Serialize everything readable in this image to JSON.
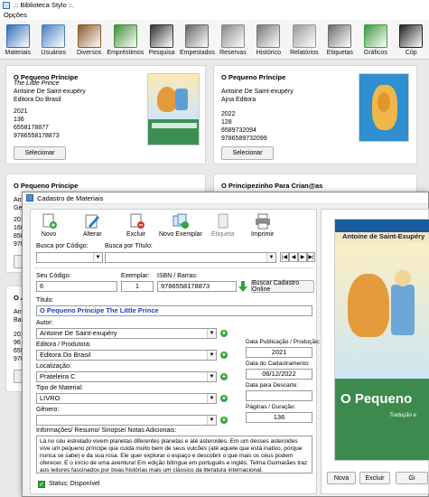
{
  "window": {
    "title": ".:: Biblioteca Stylo ::."
  },
  "menu": {
    "options": "Opções"
  },
  "toolbar": {
    "items": [
      {
        "label": "Materiais",
        "icon": "book-at-icon",
        "color": "#2f6db5"
      },
      {
        "label": "Usuários",
        "icon": "users-icon",
        "color": "#4a7fc1"
      },
      {
        "label": "Diversos",
        "icon": "bookshelf-icon",
        "color": "#8a5a2b"
      },
      {
        "label": "Empréstimos",
        "icon": "loan-icon",
        "color": "#3f8f3a"
      },
      {
        "label": "Pesquisa",
        "icon": "binoculars-icon",
        "color": "#333333"
      },
      {
        "label": "Empestados",
        "icon": "lent-books-icon",
        "color": "#666666"
      },
      {
        "label": "Reservas",
        "icon": "reservations-icon",
        "color": "#888888"
      },
      {
        "label": "Histórico",
        "icon": "history-icon",
        "color": "#777777"
      },
      {
        "label": "Relatórios",
        "icon": "reports-icon",
        "color": "#999999"
      },
      {
        "label": "Etiquetas",
        "icon": "labels-icon",
        "color": "#6b6b6b"
      },
      {
        "label": "Gráficos",
        "icon": "charts-icon",
        "color": "#3c9a3c"
      },
      {
        "label": "Cóp",
        "icon": "copy-icon",
        "color": "#222222"
      }
    ]
  },
  "cards": [
    {
      "title": "O Pequeno Príncipe",
      "subtitle": "The Little Prince",
      "author": "Antoine De Saint-exupéry",
      "publisher": "Editora Do Brasil",
      "year": "2021",
      "pages": "136",
      "isbn10": "6558178877",
      "isbn13": "9786558178873",
      "button": "Selecionar"
    },
    {
      "title": "O Pequeno Príncipe",
      "subtitle": "",
      "author": "Antoine De Saint-exupéry",
      "publisher": "Ajna Editora",
      "year": "2022",
      "pages": "128",
      "isbn10": "6589732094",
      "isbn13": "9786589732099",
      "button": "Selecionar"
    },
    {
      "title": "O Pequeno Príncipe",
      "line1": "Anto",
      "line2": "Gera",
      "line3": "2015",
      "line4": "160",
      "line5": "858",
      "line6": "978"
    },
    {
      "title": "O Principezinho Para Crian@as"
    },
    {
      "title": "O A",
      "line1": "Anto",
      "line2": "Babe",
      "line3": "2017",
      "line4": "96",
      "line5": "655",
      "line6": "978"
    }
  ],
  "dialog": {
    "title": "Cadastro de Materiais",
    "buttons": {
      "novo": "Novo",
      "alterar": "Alterar",
      "excluir": "Excluir",
      "novo_exemplar": "Novo Exemplar",
      "etiqueta": "Etiqueta",
      "imprimir": "Imprimir"
    },
    "search": {
      "by_code_label": "Busca por Código:",
      "by_title_label": "Busca por Título:"
    },
    "fields": {
      "code_label": "Seu Código:",
      "code": "6",
      "exemplar_label": "Exemplar:",
      "exemplar": "1",
      "isbn_label": "ISBN / Barras:",
      "isbn": "9786558178873",
      "fetch_online": "Buscar Cadastro Online",
      "title_label": "Título:",
      "title": "O Pequeno Príncipe The Little Prince",
      "author_label": "Autor:",
      "author": "Antoine De Saint-exupéry",
      "publisher_label": "Editora / Produtora:",
      "publisher": "Editora Do Brasil",
      "location_label": "Localização:",
      "location": "Prateleira C",
      "type_label": "Tipo de Material:",
      "type": "LIVRO",
      "genre_label": "Gênero:",
      "genre": "",
      "pub_date_label": "Data Publicação / Produção:",
      "pub_date": "2021",
      "reg_date_label": "Data do Cadastramento:",
      "reg_date": "06/12/2022",
      "discard_label": "Data para Descarte:",
      "discard": "",
      "pages_label": "Páginas / Duração:",
      "pages": "136",
      "info_label": "Informações/ Resumo/ Sinopse/ Notas Adicionais:",
      "info": "Lá no céu estrelado vivem planetas diferentes planetas e até asteroides. Em um desses asteroides vive um pequeno príncipe que cuida muito bem de seus vulcões (até aquele que está inativo, porque nunca se sabe) e da sua rosa. Ele quer explorar o espaço e descobrir o que mais os céus podem oferecer. E o início de uma aventura! Em edição bilíngue em português e inglês, Telma Guimarães traz aos leitores fascinados por boas histórias mais um clássico da literatura internacional.",
      "status": "Status: Disponível"
    },
    "cover": {
      "author": "Antoine de Saint-Exupéry",
      "title": "O Pequeno",
      "tradution": "Tradução e "
    },
    "bottom_buttons": {
      "nova": "Nova",
      "excluir": "Excluir",
      "gi": "Gi"
    }
  }
}
